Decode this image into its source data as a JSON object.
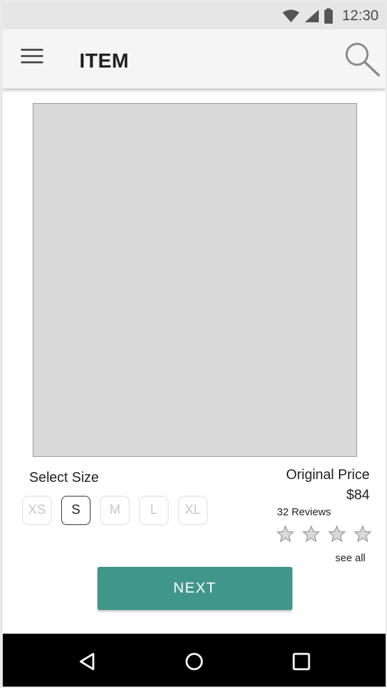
{
  "status_bar": {
    "time": "12:30",
    "icons": [
      "wifi-icon",
      "signal-icon",
      "battery-icon"
    ]
  },
  "app_bar": {
    "title": "ITEM",
    "menu_icon": "menu-icon",
    "search_icon": "search-icon"
  },
  "product": {
    "select_size_label": "Select Size",
    "sizes": [
      "XS",
      "S",
      "M",
      "L",
      "XL"
    ],
    "selected_size": "S",
    "original_price_label": "Original Price",
    "price": "$84",
    "reviews_label": "32 Reviews",
    "rating_stars_shown": 4,
    "see_all_label": "see all"
  },
  "actions": {
    "next_label": "NEXT"
  },
  "nav_bar": {
    "icons": [
      "back-icon",
      "home-icon",
      "recents-icon"
    ]
  },
  "colors": {
    "accent": "#41968a",
    "app_bar_bg": "#f5f5f5",
    "status_bar_bg": "#e6e6e6",
    "placeholder_bg": "#d9d9d9",
    "nav_bar_bg": "#000000"
  }
}
